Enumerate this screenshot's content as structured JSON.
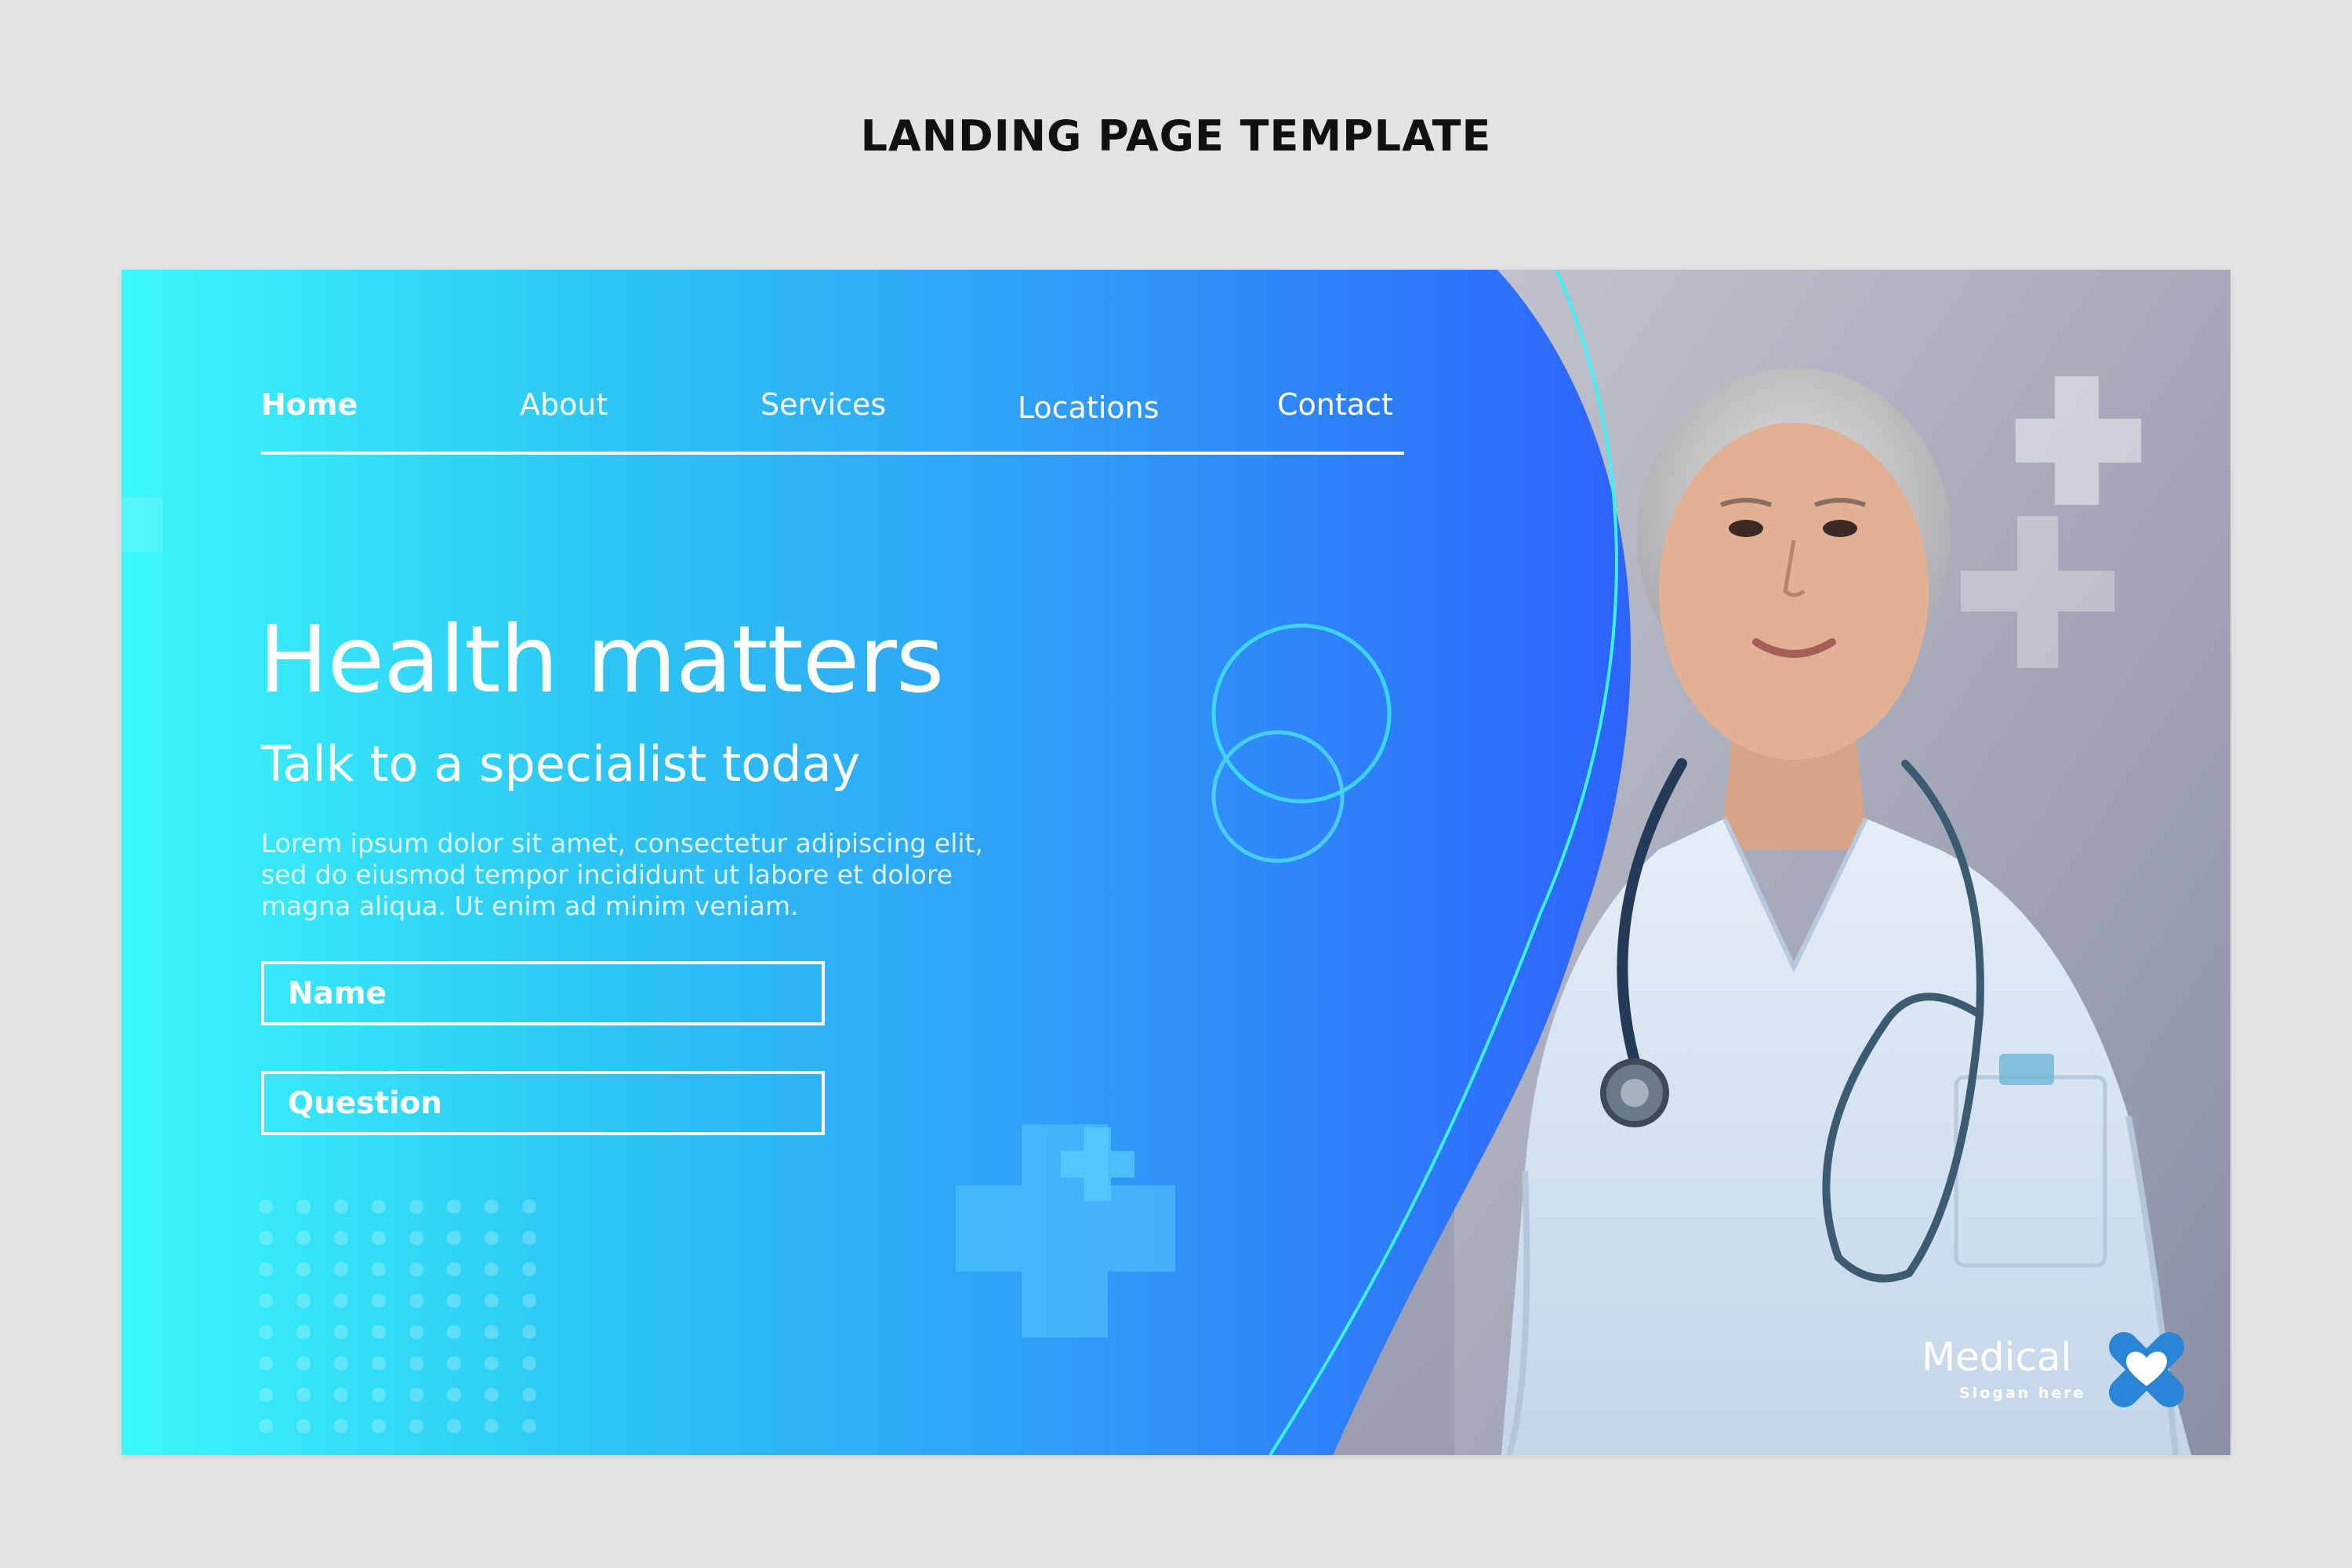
{
  "page": {
    "heading": "LANDING PAGE TEMPLATE"
  },
  "nav": {
    "items": [
      {
        "label": "Home",
        "active": true
      },
      {
        "label": "About",
        "active": false
      },
      {
        "label": "Services",
        "active": false
      },
      {
        "label": "Locations",
        "active": false
      },
      {
        "label": "Contact",
        "active": false
      }
    ]
  },
  "hero": {
    "title": "Health matters",
    "subtitle": "Talk to a specialist today",
    "body": "Lorem ipsum dolor sit amet, consectetur adipiscing elit, sed do eiusmod tempor incididunt ut labore et dolore magna aliqua. Ut enim ad minim veniam."
  },
  "form": {
    "name_label": "Name",
    "question_label": "Question"
  },
  "logo": {
    "name": "Medical",
    "slogan": "Slogan here"
  },
  "colors": {
    "gradient_start": "#3bf8fb",
    "gradient_end": "#2c4cff",
    "text": "#ffffff",
    "logo_mark": "#2a85d8"
  },
  "icons": {
    "medical_cross": "plus-cross",
    "logo_mark": "x-with-heart"
  }
}
